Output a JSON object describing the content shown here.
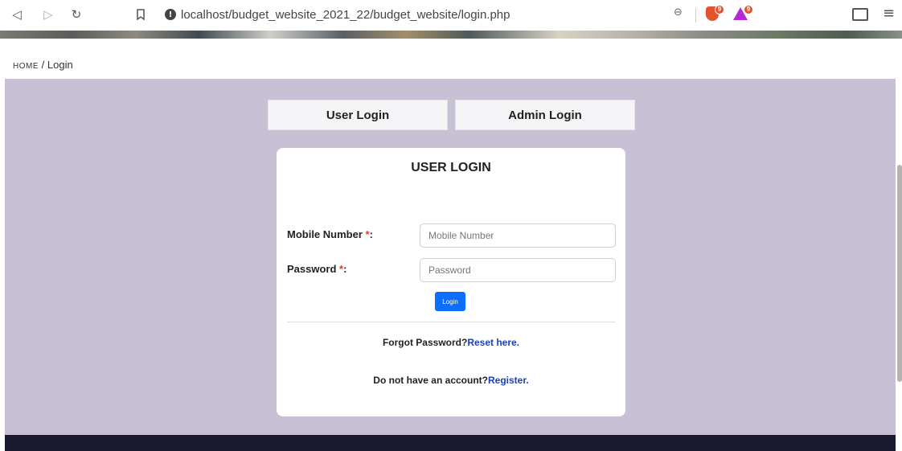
{
  "browser": {
    "url": "localhost/budget_website_2021_22/budget_website/login.php",
    "brave_badge": "9",
    "rewards_badge": "9"
  },
  "breadcrumb": {
    "home": "HOME",
    "separator": "/",
    "current": "Login"
  },
  "tabs": {
    "user": "User Login",
    "admin": "Admin Login"
  },
  "form": {
    "title": "USER LOGIN",
    "mobile_label": "Mobile Number",
    "mobile_placeholder": "Mobile Number",
    "mobile_value": "",
    "password_label": "Password",
    "password_placeholder": "Password",
    "password_value": "",
    "required_mark": "*",
    "label_suffix": ":",
    "login_button": "Login",
    "forgot_text": "Forgot Password?",
    "forgot_link": "Reset here.",
    "register_text": "Do not have an account?",
    "register_link": "Register."
  },
  "colors": {
    "page_bg": "#c8c0d5",
    "footer_bg": "#191930",
    "link": "#1a3fc0",
    "button": "#0d6efd",
    "required": "#e53935"
  },
  "icons": {
    "back": "back-icon",
    "forward": "forward-icon",
    "reload": "reload-icon",
    "bookmark": "bookmark-icon",
    "site_info": "info-icon",
    "zoom": "zoom-icon",
    "brave_shields": "brave-shield-icon",
    "rewards": "rewards-icon",
    "wallet": "wallet-icon",
    "menu": "menu-icon"
  }
}
